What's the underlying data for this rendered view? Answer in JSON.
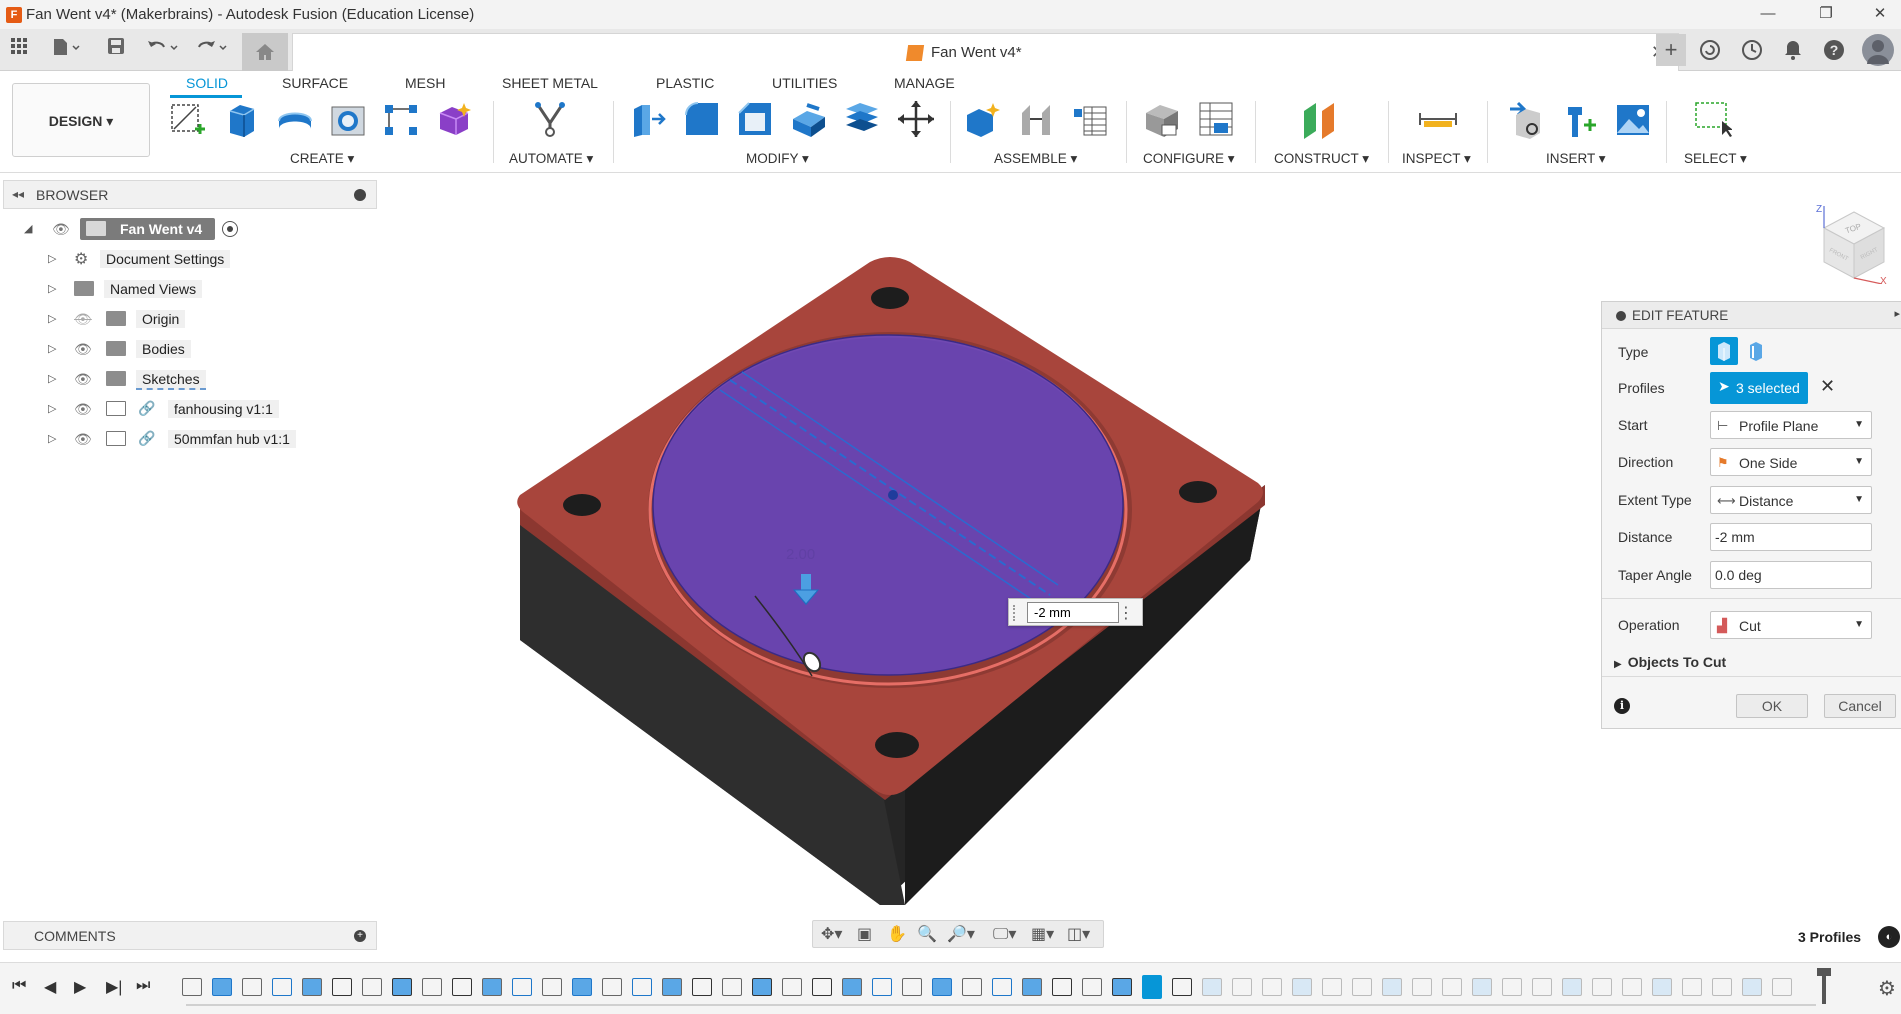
{
  "window": {
    "title": "Fan Went v4* (Makerbrains) - Autodesk Fusion (Education License)",
    "app_icon_letter": "F",
    "minimize_glyph": "—",
    "restore_glyph": "❐",
    "close_glyph": "✕"
  },
  "document_tab": {
    "title": "Fan Went v4*",
    "close_glyph": "✕"
  },
  "ribbon": {
    "workspace_button": "DESIGN ▾",
    "tabs": [
      "SOLID",
      "SURFACE",
      "MESH",
      "SHEET METAL",
      "PLASTIC",
      "UTILITIES",
      "MANAGE"
    ],
    "active_tab": "SOLID",
    "groups": {
      "create": "CREATE ▾",
      "automate": "AUTOMATE ▾",
      "modify": "MODIFY ▾",
      "assemble": "ASSEMBLE ▾",
      "configure": "CONFIGURE ▾",
      "construct": "CONSTRUCT ▾",
      "inspect": "INSPECT ▾",
      "insert": "INSERT ▾",
      "select": "SELECT ▾"
    }
  },
  "browser": {
    "title": "BROWSER",
    "root": "Fan Went v4",
    "items": [
      {
        "label": "Document Settings",
        "icon": "gear-icon"
      },
      {
        "label": "Named Views",
        "icon": "folder-icon"
      },
      {
        "label": "Origin",
        "icon": "folder-icon",
        "hidden": true
      },
      {
        "label": "Bodies",
        "icon": "folder-icon"
      },
      {
        "label": "Sketches",
        "icon": "folder-icon"
      },
      {
        "label": "fanhousing v1:1",
        "icon": "component-icon",
        "linked": true
      },
      {
        "label": "50mmfan hub v1:1",
        "icon": "component-icon",
        "linked": true
      }
    ]
  },
  "comments": {
    "title": "COMMENTS"
  },
  "viewport": {
    "dimension_label": "2.00",
    "distance_input": "-2 mm",
    "colors": {
      "plate": "#a8453c",
      "base": "#2a2a2a",
      "profile": "#6645b8",
      "background": "#ffffff"
    }
  },
  "viewcube": {
    "face_top": "TOP",
    "face_front": "FRONT",
    "face_right": "RIGHT",
    "axis_z": "Z",
    "axis_x": "X"
  },
  "edit_feature": {
    "title": "EDIT FEATURE",
    "rows": {
      "type": {
        "label": "Type"
      },
      "profiles": {
        "label": "Profiles",
        "value": "3 selected"
      },
      "start": {
        "label": "Start",
        "value": "Profile Plane"
      },
      "direction": {
        "label": "Direction",
        "value": "One Side"
      },
      "extent_type": {
        "label": "Extent Type",
        "value": "Distance"
      },
      "distance": {
        "label": "Distance",
        "value": "-2 mm"
      },
      "taper_angle": {
        "label": "Taper Angle",
        "value": "0.0 deg"
      },
      "operation": {
        "label": "Operation",
        "value": "Cut"
      }
    },
    "objects_to_cut": "Objects To Cut",
    "ok": "OK",
    "cancel": "Cancel",
    "accent": "#0696d7"
  },
  "status": {
    "profiles_count": "3 Profiles"
  }
}
